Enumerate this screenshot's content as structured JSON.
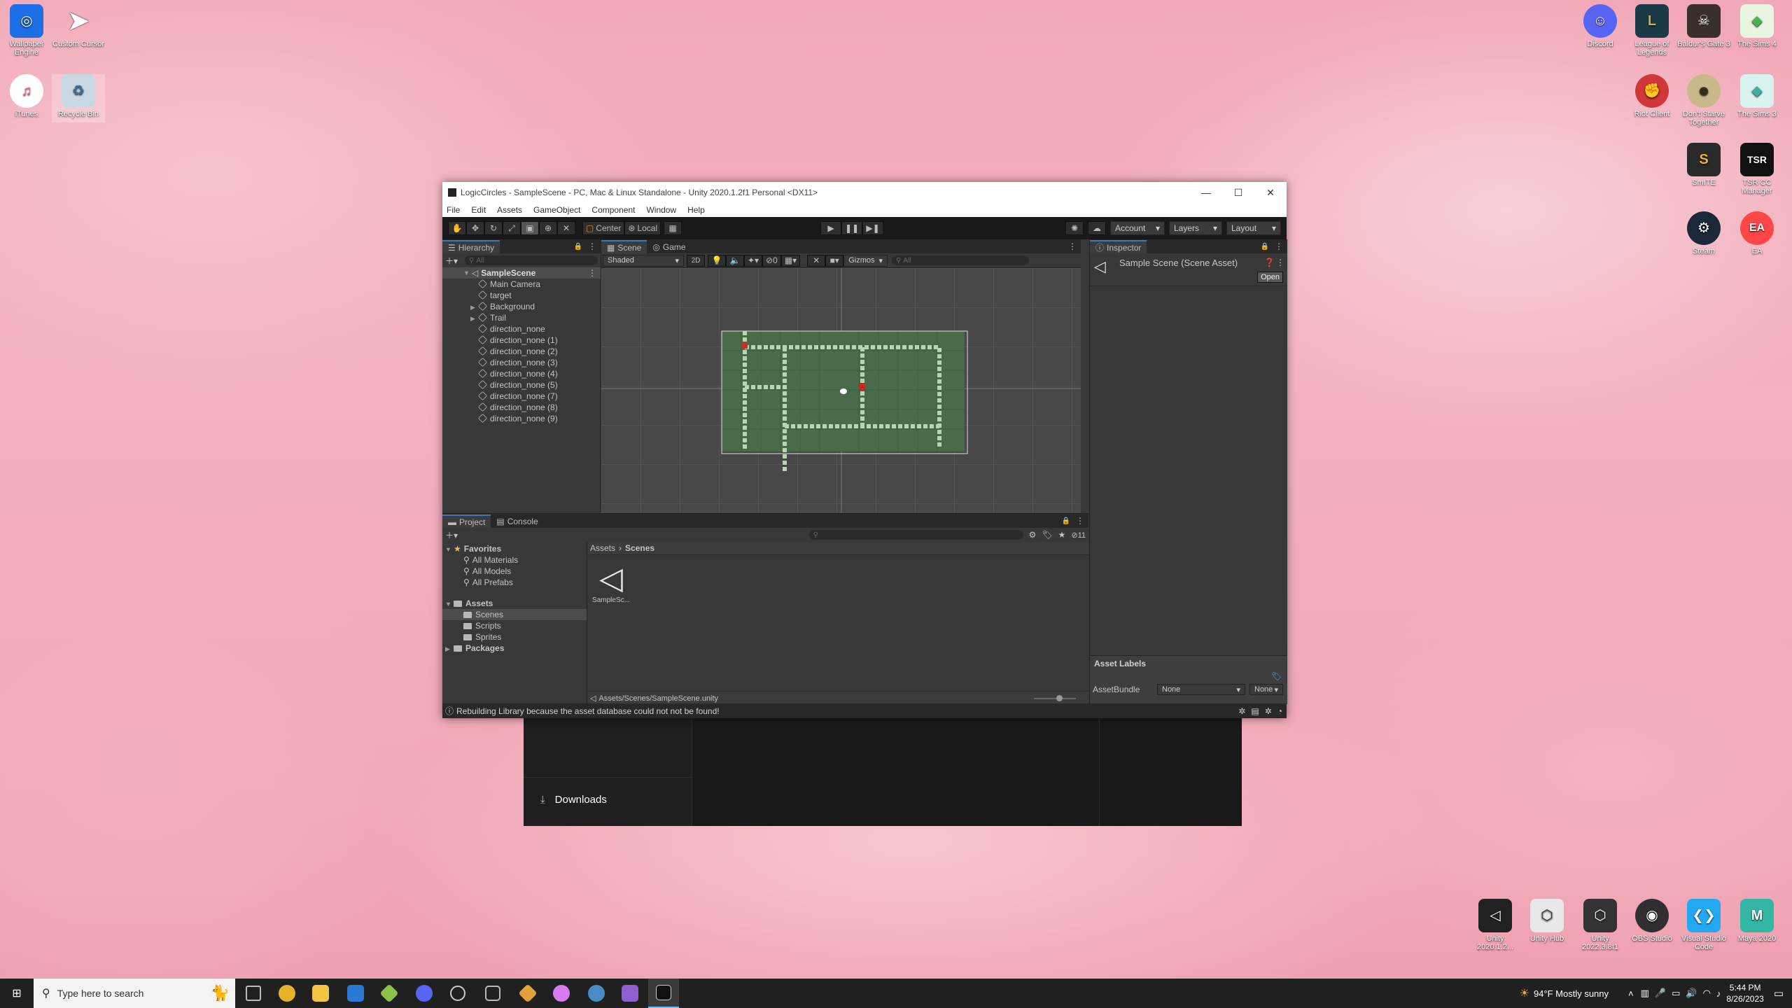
{
  "desktop": {
    "left_icons": [
      {
        "label": "Wallpaper Engine",
        "icon": "wallpaper-engine-icon",
        "color": "#1e6ee6"
      },
      {
        "label": "Custom Cursor",
        "icon": "cursor-icon",
        "color": "transparent"
      },
      {
        "label": "iTunes",
        "icon": "itunes-icon",
        "color": "#f25b8c"
      },
      {
        "label": "Recycle Bin",
        "icon": "recycle-bin-icon",
        "color": "#9fb7c8"
      }
    ],
    "right_icons": [
      {
        "label": "Discord",
        "icon": "discord-icon",
        "color": "#5865f2"
      },
      {
        "label": "League of Legends",
        "icon": "league-icon",
        "color": "#1b3a47"
      },
      {
        "label": "Baldur's Gate 3",
        "icon": "baldurs-gate-icon",
        "color": "#3a2f2b"
      },
      {
        "label": "The Sims 4",
        "icon": "sims4-icon",
        "color": "#4caf50"
      },
      {
        "label": "Riot Client",
        "icon": "riot-icon",
        "color": "#d13639"
      },
      {
        "label": "Don't Starve Together",
        "icon": "dont-starve-icon",
        "color": "#6b5a3a"
      },
      {
        "label": "The Sims 3",
        "icon": "sims3-icon",
        "color": "#3bb0a0"
      },
      {
        "label": "SmITE",
        "icon": "smite-icon",
        "color": "#2a2a2a"
      },
      {
        "label": "TSR CC Manager",
        "icon": "tsr-icon",
        "color": "#111111"
      },
      {
        "label": "Steam",
        "icon": "steam-icon",
        "color": "#1b2838"
      },
      {
        "label": "EA",
        "icon": "ea-icon",
        "color": "#ff4747"
      }
    ],
    "bottom_right_icons": [
      {
        "label": "Unity 2020.1.2...",
        "icon": "unity-icon",
        "color": "#222222"
      },
      {
        "label": "Unity Hub",
        "icon": "unity-hub-icon",
        "color": "#e8e8e8"
      },
      {
        "label": "Unity 2022.3.8f1",
        "icon": "unity-icon",
        "color": "#333333"
      },
      {
        "label": "OBS Studio",
        "icon": "obs-icon",
        "color": "#302e31"
      },
      {
        "label": "Visual Studio Code",
        "icon": "vscode-icon",
        "color": "#23a9f2"
      },
      {
        "label": "Maya 2020",
        "icon": "maya-icon",
        "color": "#33b6a3"
      }
    ]
  },
  "unity": {
    "title": "LogicCircles - SampleScene - PC, Mac & Linux Standalone - Unity 2020.1.2f1 Personal <DX11>",
    "menu": [
      "File",
      "Edit",
      "Assets",
      "GameObject",
      "Component",
      "Window",
      "Help"
    ],
    "toolbar": {
      "pivot": "Center",
      "space": "Local",
      "account": "Account",
      "layers": "Layers",
      "layout": "Layout"
    },
    "hierarchy": {
      "tab": "Hierarchy",
      "search_placeholder": "All",
      "scene": "SampleScene",
      "items": [
        {
          "name": "Main Camera",
          "expandable": false
        },
        {
          "name": "target",
          "expandable": false
        },
        {
          "name": "Background",
          "expandable": true
        },
        {
          "name": "Trail",
          "expandable": true
        },
        {
          "name": "direction_none",
          "expandable": false
        },
        {
          "name": "direction_none (1)",
          "expandable": false
        },
        {
          "name": "direction_none (2)",
          "expandable": false
        },
        {
          "name": "direction_none (3)",
          "expandable": false
        },
        {
          "name": "direction_none (4)",
          "expandable": false
        },
        {
          "name": "direction_none (5)",
          "expandable": false
        },
        {
          "name": "direction_none (7)",
          "expandable": false
        },
        {
          "name": "direction_none (8)",
          "expandable": false
        },
        {
          "name": "direction_none (9)",
          "expandable": false
        }
      ]
    },
    "scene_view": {
      "tabs": [
        "Scene",
        "Game"
      ],
      "shading": "Shaded",
      "mode_2d": "2D",
      "hidden_count": "0",
      "gizmos": "Gizmos",
      "search_placeholder": "All"
    },
    "inspector": {
      "tab": "Inspector",
      "asset_title": "Sample Scene (Scene Asset)",
      "open_button": "Open",
      "asset_labels": "Asset Labels",
      "asset_bundle_label": "AssetBundle",
      "asset_bundle_value": "None",
      "variant_value": "None"
    },
    "project": {
      "tabs": [
        "Project",
        "Console"
      ],
      "hidden_count": "11",
      "favorites_label": "Favorites",
      "favorites": [
        "All Materials",
        "All Models",
        "All Prefabs"
      ],
      "assets_label": "Assets",
      "asset_folders": [
        "Scenes",
        "Scripts",
        "Sprites"
      ],
      "packages_label": "Packages",
      "breadcrumb": [
        "Assets",
        "Scenes"
      ],
      "files": [
        {
          "name": "SampleSc...",
          "icon": "unity-scene-icon"
        }
      ],
      "path": "Assets/Scenes/SampleScene.unity"
    },
    "status": "Rebuilding Library because the asset database could not not be found!"
  },
  "explorer_behind": {
    "downloads": "Downloads"
  },
  "taskbar": {
    "search_placeholder": "Type here to search",
    "apps": [
      {
        "icon": "task-view-icon",
        "color": "#555555"
      },
      {
        "icon": "chrome-icon",
        "color": "#e4b32a"
      },
      {
        "icon": "file-explorer-icon",
        "color": "#f4c542"
      },
      {
        "icon": "mail-icon",
        "color": "#2a7ad5"
      },
      {
        "icon": "gitkraken-icon",
        "color": "#8dc149"
      },
      {
        "icon": "discord-icon",
        "color": "#5865f2"
      },
      {
        "icon": "unity-hub-icon",
        "color": "#cccccc"
      },
      {
        "icon": "unity-icon",
        "color": "#bbbbbb"
      },
      {
        "icon": "git-icon",
        "color": "#e2a23b"
      },
      {
        "icon": "itunes-icon",
        "color": "#d77bf2"
      },
      {
        "icon": "steam-icon",
        "color": "#4a8bc4"
      },
      {
        "icon": "visual-studio-icon",
        "color": "#8e5fd1"
      },
      {
        "icon": "unity-editor-icon",
        "color": "#111111"
      }
    ],
    "weather": "94°F  Mostly sunny",
    "time": "5:44 PM",
    "date": "8/26/2023"
  }
}
